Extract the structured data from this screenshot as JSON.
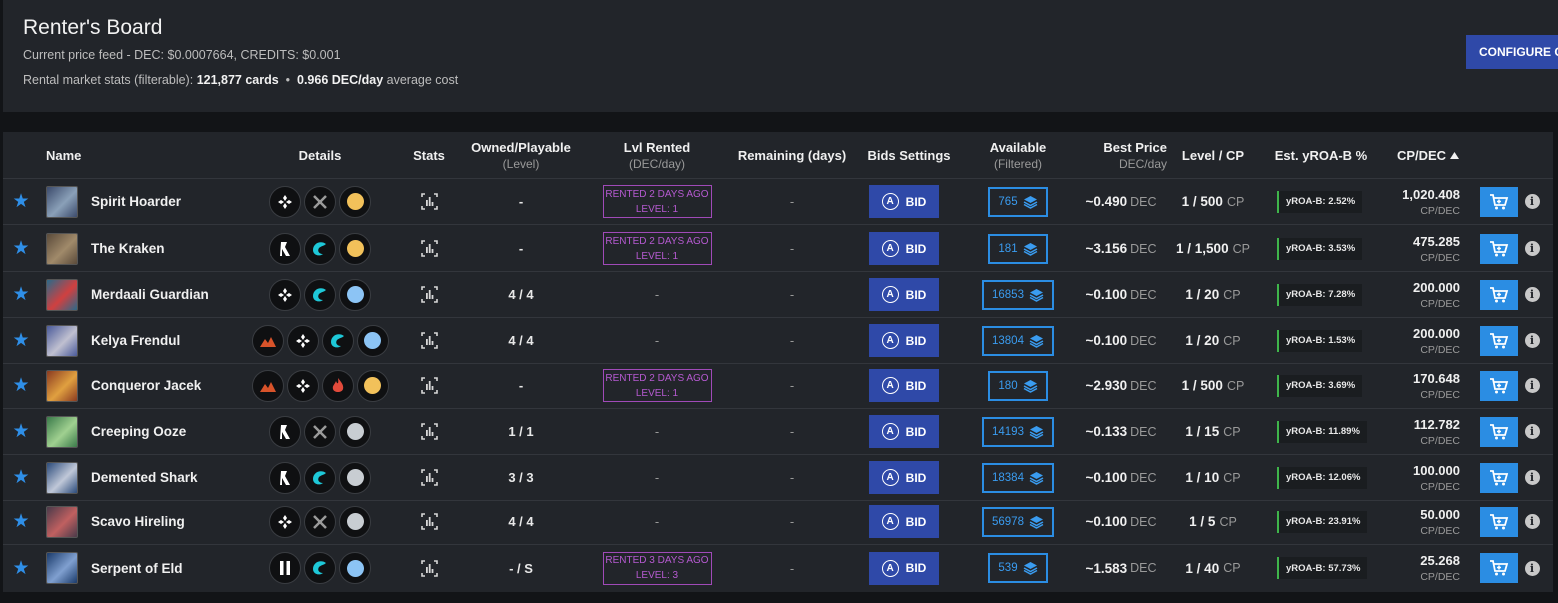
{
  "header": {
    "title": "Renter's Board",
    "price_feed": "Current price feed - DEC: $0.0007664, CREDITS: $0.001",
    "stats_prefix": "Rental market stats (filterable):",
    "stats_cards": "121,877 cards",
    "stats_sep": "•",
    "stats_cost": "0.966 DEC/day",
    "stats_suffix": "average cost",
    "configure_label": "CONFIGURE CP"
  },
  "columns": {
    "name": "Name",
    "details": "Details",
    "stats": "Stats",
    "owned": "Owned/Playable",
    "owned_sub": "(Level)",
    "lvl_rented": "Lvl Rented",
    "lvl_rented_sub": "(DEC/day)",
    "remaining": "Remaining (days)",
    "bids": "Bids Settings",
    "available": "Available",
    "available_sub": "(Filtered)",
    "best_price": "Best Price",
    "best_price_sub": "DEC/day",
    "level_cp": "Level / CP",
    "yroa": "Est. yROA-B %",
    "cpdec": "CP/DEC",
    "sort_icon": "caret-up-icon"
  },
  "labels": {
    "bid": "BID",
    "dec": "DEC",
    "cp": "CP",
    "cpdec_unit": "CP/DEC",
    "dash": "-"
  },
  "colors": {
    "accent_blue": "#2b8de3",
    "bid_blue": "#2f49a8",
    "rented_purple": "#a04ab8",
    "yroa_green": "#3fb54b"
  },
  "rows": [
    {
      "name": "Spirit Hoarder",
      "portrait_colors": [
        "#3b4a6b",
        "#8aa0b8"
      ],
      "details": [
        "neutral-icon",
        "attack-melee-icon",
        "gold-rarity-dot"
      ],
      "owned": "-",
      "rented": true,
      "rented_line1": "RENTED 2 DAYS AGO",
      "rented_line2": "LEVEL: 1",
      "remaining": "-",
      "available": "765",
      "price": "~0.490",
      "level_cp": "1 / 500",
      "yroa": "yROA-B: 2.52%",
      "cpdec": "1,020.408"
    },
    {
      "name": "The Kraken",
      "portrait_colors": [
        "#5a4a3a",
        "#a08a6a"
      ],
      "details": [
        "dragon-icon",
        "water-icon",
        "gold-rarity-dot"
      ],
      "owned": "-",
      "rented": true,
      "rented_line1": "RENTED 2 DAYS AGO",
      "rented_line2": "LEVEL: 1",
      "remaining": "-",
      "available": "181",
      "price": "~3.156",
      "level_cp": "1 / 1,500",
      "yroa": "yROA-B: 3.53%",
      "cpdec": "475.285"
    },
    {
      "name": "Merdaali Guardian",
      "portrait_colors": [
        "#2a6a8a",
        "#d04040"
      ],
      "details": [
        "neutral-icon",
        "water-icon",
        "blue-rarity-dot"
      ],
      "owned": "4 / 4",
      "rented": false,
      "rented_value": "-",
      "remaining": "-",
      "available": "16853",
      "price": "~0.100",
      "level_cp": "1 / 20",
      "yroa": "yROA-B: 7.28%",
      "cpdec": "200.000"
    },
    {
      "name": "Kelya Frendul",
      "portrait_colors": [
        "#4a5a9a",
        "#c0c0d0"
      ],
      "details": [
        "earth-icon",
        "neutral-icon",
        "water-icon",
        "blue-rarity-dot"
      ],
      "owned": "4 / 4",
      "rented": false,
      "rented_value": "-",
      "remaining": "-",
      "available": "13804",
      "price": "~0.100",
      "level_cp": "1 / 20",
      "yroa": "yROA-B: 1.53%",
      "cpdec": "200.000"
    },
    {
      "name": "Conqueror Jacek",
      "portrait_colors": [
        "#8a3a20",
        "#e0a040"
      ],
      "details": [
        "earth-icon",
        "neutral-icon",
        "fire-icon",
        "gold-rarity-dot"
      ],
      "owned": "-",
      "rented": true,
      "rented_line1": "RENTED 2 DAYS AGO",
      "rented_line2": "LEVEL: 1",
      "remaining": "-",
      "available": "180",
      "price": "~2.930",
      "level_cp": "1 / 500",
      "yroa": "yROA-B: 3.69%",
      "cpdec": "170.648"
    },
    {
      "name": "Creeping Ooze",
      "portrait_colors": [
        "#3a7a4a",
        "#a0d090"
      ],
      "details": [
        "dragon-icon",
        "attack-melee-icon",
        "silver-rarity-dot"
      ],
      "owned": "1 / 1",
      "rented": false,
      "rented_value": "-",
      "remaining": "-",
      "available": "14193",
      "price": "~0.133",
      "level_cp": "1 / 15",
      "yroa": "yROA-B: 11.89%",
      "cpdec": "112.782"
    },
    {
      "name": "Demented Shark",
      "portrait_colors": [
        "#2a4a7a",
        "#c0c8d8"
      ],
      "details": [
        "dragon-icon",
        "water-icon",
        "silver-rarity-dot"
      ],
      "owned": "3 / 3",
      "rented": false,
      "rented_value": "-",
      "remaining": "-",
      "available": "18384",
      "price": "~0.100",
      "level_cp": "1 / 10",
      "yroa": "yROA-B: 12.06%",
      "cpdec": "100.000"
    },
    {
      "name": "Scavo Hireling",
      "portrait_colors": [
        "#4a3a4a",
        "#c06060"
      ],
      "details": [
        "neutral-icon",
        "attack-melee-icon",
        "silver-rarity-dot"
      ],
      "owned": "4 / 4",
      "rented": false,
      "rented_value": "-",
      "remaining": "-",
      "available": "56978",
      "price": "~0.100",
      "level_cp": "1 / 5",
      "yroa": "yROA-B: 23.91%",
      "cpdec": "50.000"
    },
    {
      "name": "Serpent of Eld",
      "portrait_colors": [
        "#1a3a6a",
        "#80a0d0"
      ],
      "details": [
        "pause-icon",
        "water-icon",
        "blue-rarity-dot"
      ],
      "owned": "- / S",
      "rented": true,
      "rented_line1": "RENTED 3 DAYS AGO",
      "rented_line2": "LEVEL: 3",
      "remaining": "-",
      "available": "539",
      "price": "~1.583",
      "level_cp": "1 / 40",
      "yroa": "yROA-B: 57.73%",
      "cpdec": "25.268"
    }
  ]
}
